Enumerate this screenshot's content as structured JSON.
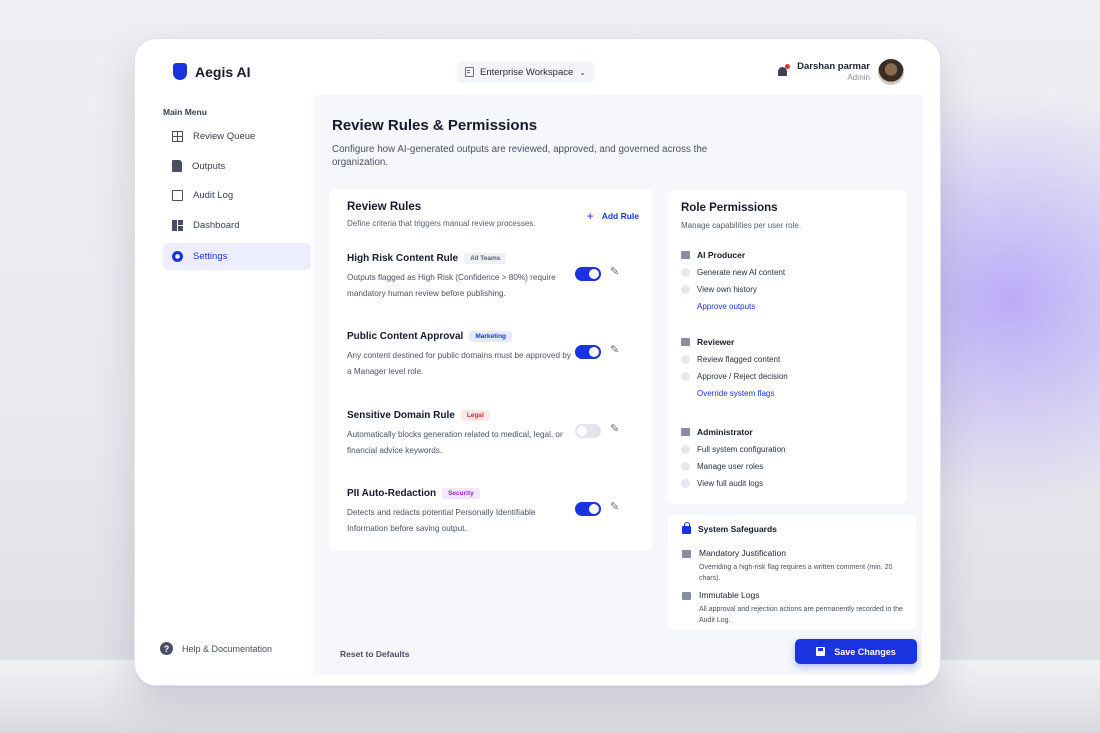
{
  "app": {
    "name": "Aegis AI"
  },
  "topbar": {
    "workspace": "Enterprise Workspace",
    "user_name": "Darshan parmar",
    "user_role": "Admin"
  },
  "sidebar": {
    "menu_title": "Main Menu",
    "items": [
      {
        "label": "Review Queue",
        "icon": "table-icon"
      },
      {
        "label": "Outputs",
        "icon": "document-icon"
      },
      {
        "label": "Audit Log",
        "icon": "audit-log-icon"
      },
      {
        "label": "Dashboard",
        "icon": "dashboard-icon"
      },
      {
        "label": "Settings",
        "icon": "gear-icon",
        "active": true
      }
    ],
    "help": "Help & Documentation"
  },
  "page": {
    "title": "Review Rules & Permissions",
    "subtitle": "Configure how AI-generated outputs are reviewed, approved, and governed across the organization."
  },
  "review_rules": {
    "title": "Review Rules",
    "subtitle": "Define criteria that triggers manual review processes.",
    "add_label": "Add Rule",
    "rules": [
      {
        "name": "High Risk Content Rule",
        "tag": "All Teams",
        "tag_color": "#5a5e70",
        "tag_bg": "#eef0f4",
        "description": "Outputs flagged as High Risk (Confidence > 80%) require mandatory human review before publishing.",
        "enabled": true
      },
      {
        "name": "Public Content Approval",
        "tag": "Marketing",
        "tag_color": "#1a33e0",
        "tag_bg": "#e6eaff",
        "description": "Any content destined for public domains must be approved by a Manager level role.",
        "enabled": true
      },
      {
        "name": "Sensitive Domain Rule",
        "tag": "Legal",
        "tag_color": "#d4262c",
        "tag_bg": "#fde8ea",
        "description": "Automatically blocks generation related to medical, legal, or financial advice keywords.",
        "enabled": false
      },
      {
        "name": "PII Auto-Redaction",
        "tag": "Security",
        "tag_color": "#9b27d6",
        "tag_bg": "#f5e6ff",
        "description": "Detects and redacts potential Personally Identifiable Information before saving output.",
        "enabled": true
      }
    ]
  },
  "role_permissions": {
    "title": "Role Permissions",
    "subtitle": "Manage capabilities per user role.",
    "roles": [
      {
        "name": "AI Producer",
        "permissions": [
          "Generate new AI content",
          "View own history"
        ],
        "link": "Approve outputs"
      },
      {
        "name": "Reviewer",
        "permissions": [
          "Review flagged content",
          "Approve / Reject decision"
        ],
        "link": "Override system flags"
      },
      {
        "name": "Administrator",
        "permissions": [
          "Full system configuration",
          "Manage user roles",
          "View full audit logs"
        ]
      }
    ]
  },
  "safeguards": {
    "title": "System Safeguards",
    "items": [
      {
        "title": "Mandatory Justification",
        "description": "Overriding a high-risk flag requires a written comment (min. 20 chars)."
      },
      {
        "title": "Immutable Logs",
        "description": "All approval and rejection actions are permanently recorded in the Audit Log."
      }
    ]
  },
  "footer": {
    "reset_label": "Reset to Defaults",
    "save_label": "Save Changes"
  }
}
